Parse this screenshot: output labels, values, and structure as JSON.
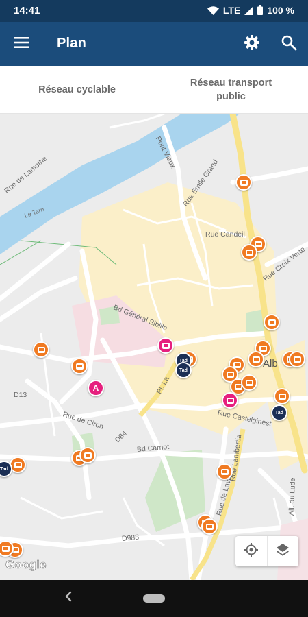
{
  "status_bar": {
    "time": "14:41",
    "network": "LTE",
    "battery": "100 %",
    "icons": [
      "wifi-icon",
      "signal-icon",
      "battery-icon"
    ]
  },
  "app_bar": {
    "title": "Plan",
    "menu_icon": "menu-icon",
    "settings_icon": "gear-icon",
    "search_icon": "search-icon",
    "color": "#1b4c7b"
  },
  "tabs": [
    {
      "label": "Réseau cyclable"
    },
    {
      "label": "Réseau transport public"
    }
  ],
  "map": {
    "street_labels": {
      "rue_de_lamothe": "Rue de Lamothe",
      "le_tarn": "Le Tarn",
      "pont_vieux": "Pont Vieux",
      "rue_emile_grand": "Rue Émile Grand",
      "rue_candeil": "Rue Candeil",
      "rue_croix_verte": "Rue Croix Verte",
      "bd_general_sibille": "Bd Général Sibille",
      "d13": "D13",
      "rue_de_ciron": "Rue de Ciron",
      "d84": "D84",
      "pl_lapeyrouse": "Pl. La",
      "alb": "Alb",
      "rue_castelginest": "Rue Castelginest",
      "bd_carnot": "Bd Carnot",
      "rue_de_lavaur": "Rue de Lavaur",
      "d988": "D988",
      "rue_lambertia": "Rue Lambertia",
      "all_du_lude": "All. du Lude"
    },
    "marker_colors": {
      "bus": "#f07a22",
      "special": "#e6207e",
      "tad": "#1b2f55"
    },
    "badge_letter": "A",
    "tad_label": "Tad",
    "google_logo": "Google",
    "controls": {
      "locate_icon": "my-location-icon",
      "layers_icon": "layers-icon"
    }
  },
  "nav_bar": {
    "back_icon": "back-chevron-icon",
    "home_icon": "home-pill-icon"
  }
}
